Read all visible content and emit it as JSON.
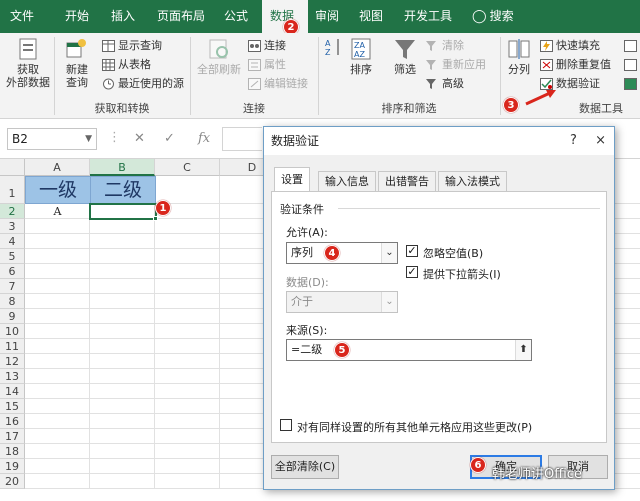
{
  "tabs": [
    "文件",
    "开始",
    "插入",
    "页面布局",
    "公式",
    "数据",
    "审阅",
    "视图",
    "开发工具"
  ],
  "search_label": "搜索",
  "ribbon": {
    "get_external": "获取\n外部数据",
    "new_query": "新建\n查询",
    "show_queries": "显示查询",
    "from_table": "从表格",
    "recent_sources": "最近使用的源",
    "group_get": "获取和转换",
    "refresh_all": "全部刷新",
    "connections": "连接",
    "properties": "属性",
    "edit_links": "编辑链接",
    "group_conn": "连接",
    "sort": "排序",
    "filter": "筛选",
    "clear": "清除",
    "reapply": "重新应用",
    "advanced": "高级",
    "group_sort": "排序和筛选",
    "split": "分列",
    "flash_fill": "快速填充",
    "remove_dup": "删除重复值",
    "data_validation": "数据验证",
    "group_tools": "数据工具"
  },
  "namebox": "B2",
  "fx_label": "fx",
  "columns": [
    "A",
    "B",
    "C",
    "D"
  ],
  "rows": [
    "1",
    "2",
    "3",
    "4",
    "5",
    "6",
    "7",
    "8",
    "9",
    "10",
    "11",
    "12",
    "13",
    "14",
    "15",
    "16",
    "17",
    "18",
    "19",
    "20"
  ],
  "cells": {
    "a1": "一级",
    "b1": "二级",
    "a2": "A"
  },
  "badges": [
    "1",
    "2",
    "3",
    "4",
    "5",
    "6"
  ],
  "dialog": {
    "title": "数据验证",
    "tabs": [
      "设置",
      "输入信息",
      "出错警告",
      "输入法模式"
    ],
    "section": "验证条件",
    "allow_label": "允许(A):",
    "allow_value": "序列",
    "ignore_blank": "忽略空值(B)",
    "dropdown_arrow": "提供下拉箭头(I)",
    "data_label": "数据(D):",
    "data_value": "介于",
    "source_label": "来源(S):",
    "source_value": "=二级",
    "apply_all": "对有同样设置的所有其他单元格应用这些更改(P)",
    "clear_all": "全部清除(C)",
    "ok": "确定",
    "cancel": "取消",
    "help": "?",
    "close": "×"
  },
  "watermark": "韩老师讲Office"
}
